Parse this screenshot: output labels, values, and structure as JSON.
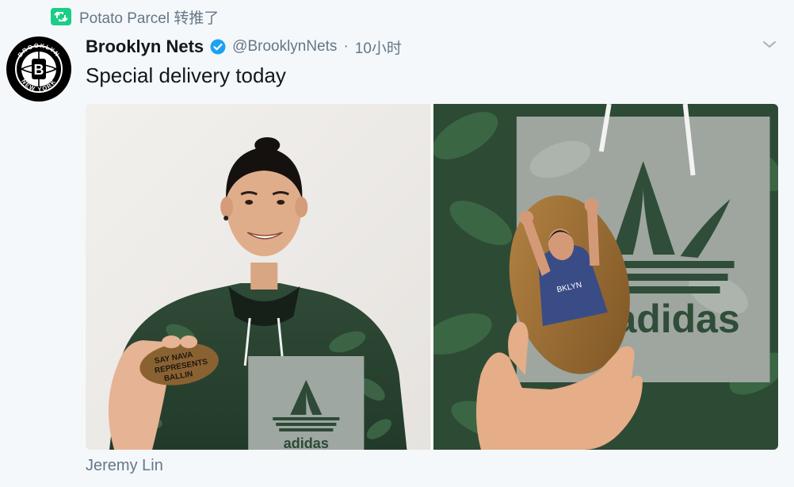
{
  "retweet": {
    "icon": "retweet-icon",
    "text": "Potato Parcel 转推了"
  },
  "tweet": {
    "author_name": "Brooklyn Nets",
    "handle": "@BrooklynNets",
    "separator": "·",
    "time": "10小时",
    "text": "Special delivery today",
    "verified": true,
    "avatar": {
      "text_top": "BROOKLYN",
      "text_bottom": "NEW YORK",
      "letter": "B"
    }
  },
  "media": {
    "left_photo": {
      "description_icon": "jeremy-lin-holding-potato-photo"
    },
    "right_photo": {
      "description_icon": "hand-holding-printed-potato-photo",
      "shirt_text": "adidas"
    }
  },
  "caption": "Jeremy Lin",
  "colors": {
    "accent": "#1da1f2",
    "retweet_green": "#19cf86",
    "muted": "#657786",
    "text": "#14171a",
    "background": "#f5f8fa"
  }
}
